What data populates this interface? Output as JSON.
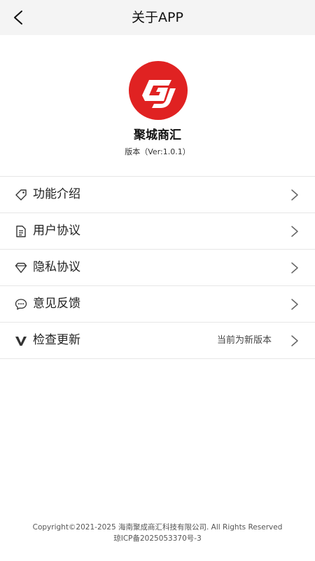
{
  "header": {
    "title": "关于APP"
  },
  "app": {
    "name": "聚城商汇",
    "version": "版本（Ver:1.0.1）"
  },
  "menu": [
    {
      "label": "功能介绍",
      "value": "",
      "icon": "tag-icon"
    },
    {
      "label": "用户协议",
      "value": "",
      "icon": "document-icon"
    },
    {
      "label": "隐私协议",
      "value": "",
      "icon": "diamond-icon"
    },
    {
      "label": "意见反馈",
      "value": "",
      "icon": "chat-bubble-icon"
    },
    {
      "label": "检查更新",
      "value": "当前为新版本",
      "icon": "v-icon"
    }
  ],
  "footer": {
    "copyright": "Copyright©2021-2025 海南聚成商汇科技有限公司. All Rights Reserved",
    "icp": "琼ICP备2025053370号-3"
  },
  "colors": {
    "brand_red": "#e02222",
    "header_bg": "#f4f4f4",
    "divider": "#e6e6e6"
  }
}
